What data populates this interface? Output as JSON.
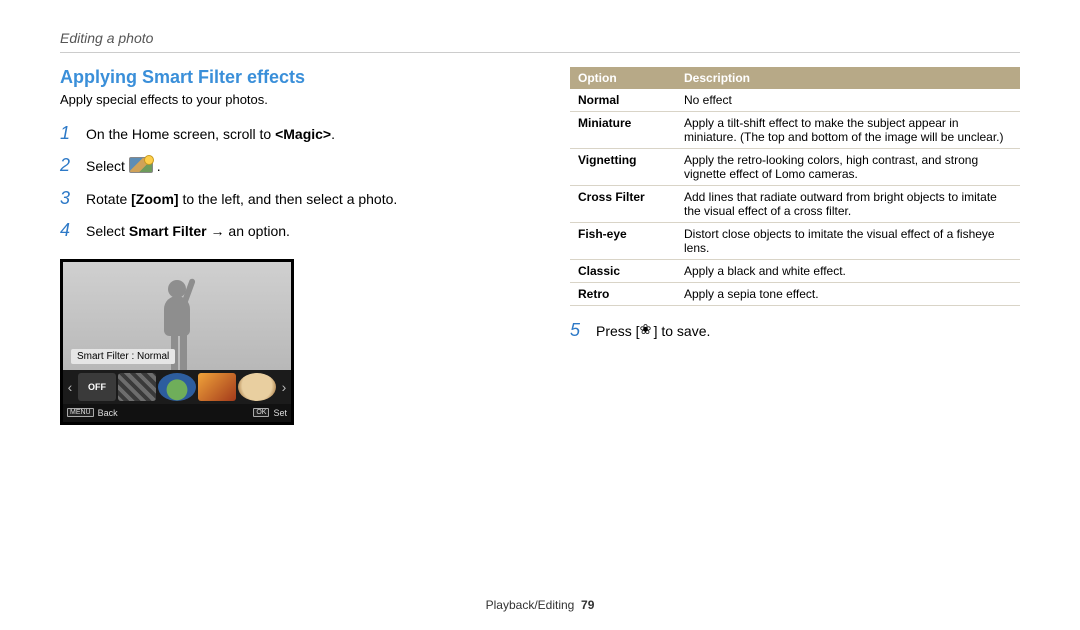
{
  "breadcrumb": "Editing a photo",
  "section_title": "Applying Smart Filter effects",
  "subtitle": "Apply special effects to your photos.",
  "steps": {
    "s1": {
      "num": "1",
      "pre": "On the Home screen, scroll to ",
      "bold": "<Magic>",
      "post": "."
    },
    "s2": {
      "num": "2",
      "pre": "Select ",
      "post": " ."
    },
    "s3": {
      "num": "3",
      "pre": "Rotate ",
      "bold": "[Zoom]",
      "post": " to the left, and then select a photo."
    },
    "s4": {
      "num": "4",
      "pre": "Select ",
      "bold": "Smart Filter",
      "post": " → an option."
    },
    "s5": {
      "num": "5",
      "pre": "Press [",
      "post": "] to save."
    }
  },
  "camera": {
    "label": "Smart Filter : Normal",
    "off": "OFF",
    "menu": "MENU",
    "back": "Back",
    "ok": "OK",
    "set": "Set"
  },
  "table": {
    "h_option": "Option",
    "h_desc": "Description",
    "rows": [
      {
        "opt": "Normal",
        "desc": "No effect"
      },
      {
        "opt": "Miniature",
        "desc": "Apply a tilt-shift effect to make the subject appear in miniature. (The top and bottom of the image will be unclear.)"
      },
      {
        "opt": "Vignetting",
        "desc": "Apply the retro-looking colors, high contrast, and strong vignette effect of Lomo cameras."
      },
      {
        "opt": "Cross Filter",
        "desc": "Add lines that radiate outward from bright objects to imitate the visual effect of a cross filter."
      },
      {
        "opt": "Fish-eye",
        "desc": "Distort close objects to imitate the visual effect of a fisheye lens."
      },
      {
        "opt": "Classic",
        "desc": "Apply a black and white effect."
      },
      {
        "opt": "Retro",
        "desc": "Apply a sepia tone effect."
      }
    ]
  },
  "footer": {
    "section": "Playback/Editing",
    "page": "79"
  }
}
